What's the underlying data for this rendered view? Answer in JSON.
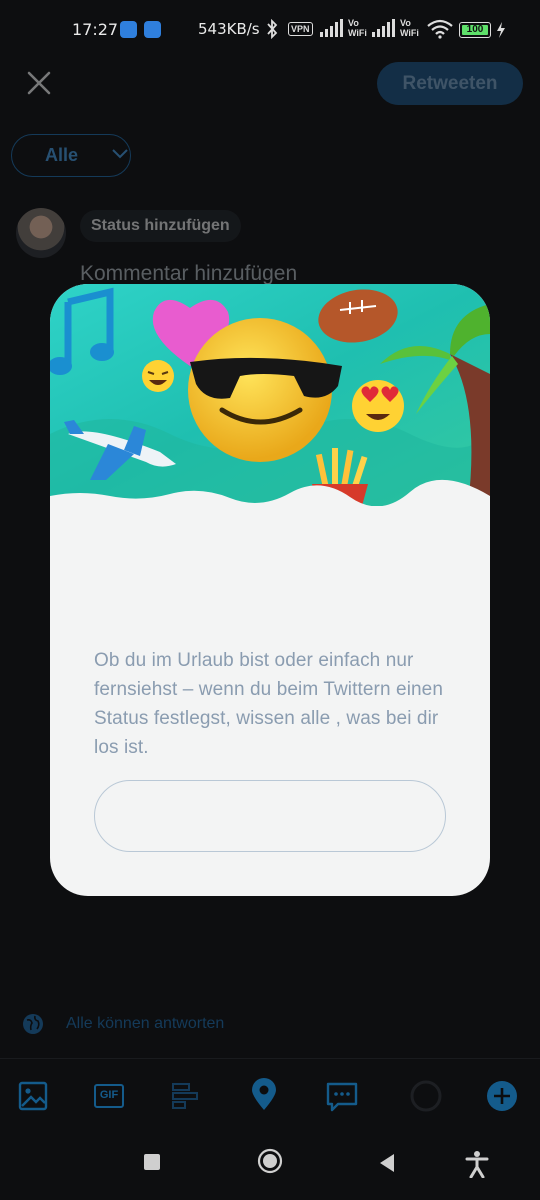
{
  "status_bar": {
    "time": "17:27",
    "network_speed": "543KB/s",
    "vpn_label": "VPN",
    "vowifi_label_1": "Vo\nWiFi",
    "vowifi_label_2": "Vo\nWiFi",
    "battery_level": "100",
    "icons": [
      "message-app-icon",
      "phone-app-icon",
      "bluetooth-icon",
      "vpn-icon",
      "signal-icon",
      "signal-icon",
      "wifi-icon",
      "battery-icon",
      "charging-icon"
    ]
  },
  "compose": {
    "close_icon": "close-icon",
    "retweet_button": "Retweeten",
    "audience_selector": "Alle",
    "status_pill": "Status hinzufügen",
    "comment_placeholder": "Kommentar hinzufügen",
    "reply_setting": "Alle können antworten"
  },
  "toolbar": {
    "items": [
      "image-icon",
      "gif-icon",
      "poll-icon",
      "location-icon",
      "comment-icon",
      "progress-ring-icon",
      "add-icon"
    ],
    "gif_label": "GIF"
  },
  "modal": {
    "body": "Ob du im Urlaub bist oder einfach nur fernsiehst – wenn du beim Twittern einen Status festlegst, wissen alle , was bei dir los ist.",
    "cta_label": "",
    "hero_icons": [
      "music-note-icon",
      "heart-icon",
      "laughing-emoji-icon",
      "sunglasses-emoji-icon",
      "football-icon",
      "palm-tree-icon",
      "heart-eyes-emoji-icon",
      "airplane-icon",
      "fries-icon"
    ]
  },
  "colors": {
    "accent": "#1d9bf0",
    "background": "#0d0e10",
    "modal_bg": "#f3f4f4",
    "body_text": "#8a9cb0"
  },
  "navbar": [
    "recents-square-button",
    "home-circle-button",
    "back-triangle-button",
    "accessibility-button"
  ]
}
